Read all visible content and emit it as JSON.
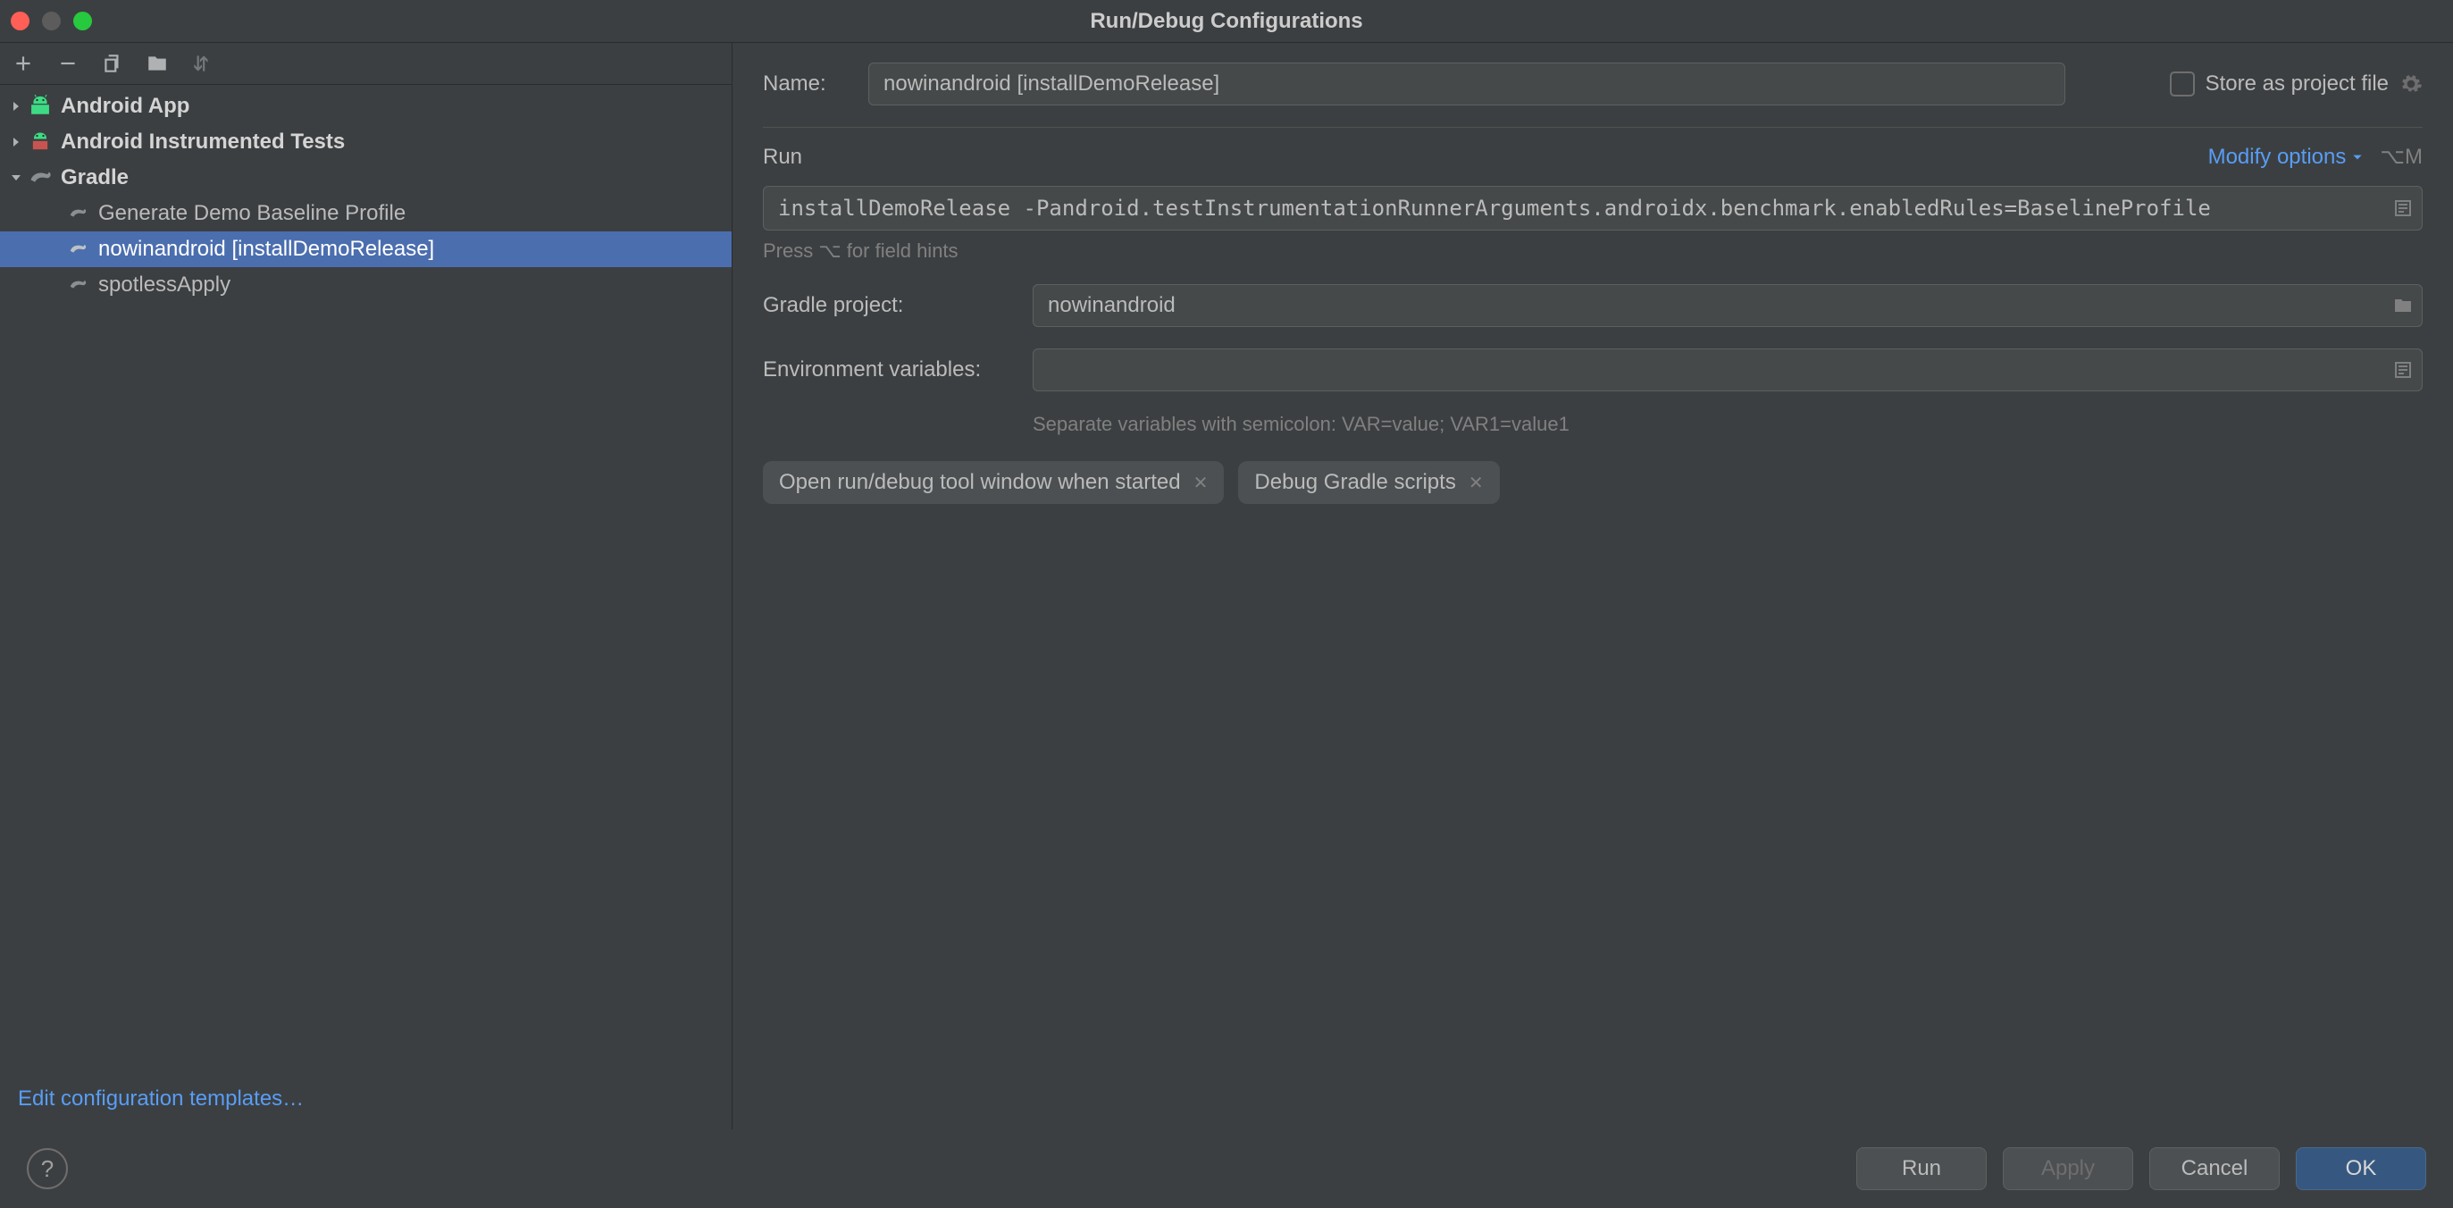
{
  "window": {
    "title": "Run/Debug Configurations"
  },
  "toolbar": {
    "add": "Add",
    "remove": "Remove",
    "copy": "Copy",
    "save": "Save",
    "sort": "Sort"
  },
  "tree": {
    "groups": [
      {
        "label": "Android App",
        "expanded": false,
        "icon": "android"
      },
      {
        "label": "Android Instrumented Tests",
        "expanded": false,
        "icon": "android-test"
      },
      {
        "label": "Gradle",
        "expanded": true,
        "icon": "gradle",
        "children": [
          {
            "label": "Generate Demo Baseline Profile",
            "selected": false
          },
          {
            "label": "nowinandroid [installDemoRelease]",
            "selected": true
          },
          {
            "label": "spotlessApply",
            "selected": false
          }
        ]
      }
    ],
    "editTemplates": "Edit configuration templates…"
  },
  "form": {
    "nameLabel": "Name:",
    "nameValue": "nowinandroid [installDemoRelease]",
    "storeLabel": "Store as project file",
    "runSection": "Run",
    "modifyOptions": "Modify options",
    "modifyShortcut": "⌥M",
    "tasksValue": "installDemoRelease -Pandroid.testInstrumentationRunnerArguments.androidx.benchmark.enabledRules=BaselineProfile",
    "tasksHint": "Press ⌥ for field hints",
    "gradleProjectLabel": "Gradle project:",
    "gradleProjectValue": "nowinandroid",
    "envLabel": "Environment variables:",
    "envValue": "",
    "envHint": "Separate variables with semicolon: VAR=value; VAR1=value1",
    "chips": [
      "Open run/debug tool window when started",
      "Debug Gradle scripts"
    ]
  },
  "buttons": {
    "run": "Run",
    "apply": "Apply",
    "cancel": "Cancel",
    "ok": "OK",
    "help": "?"
  }
}
